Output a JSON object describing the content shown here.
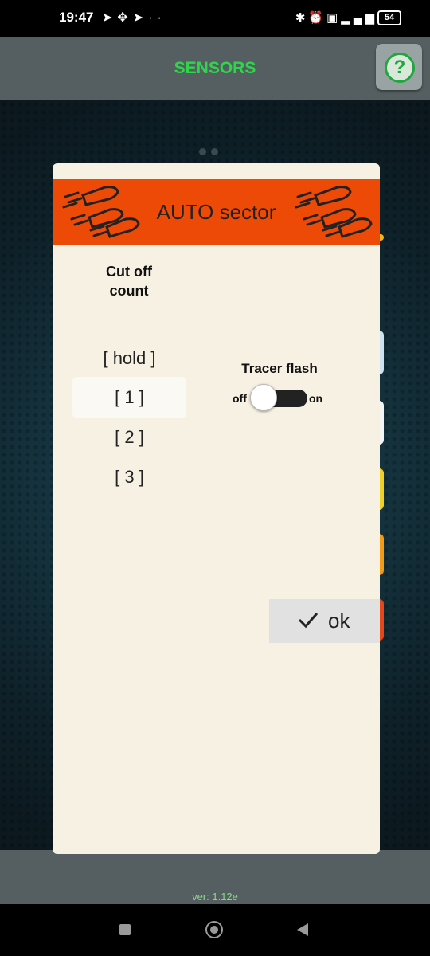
{
  "status_bar": {
    "time": "19:47",
    "left_icons": [
      "telegram-icon",
      "pinwheel-icon",
      "telegram-icon",
      "dots-icon"
    ],
    "right_icons": [
      "bluetooth-icon",
      "alarm-icon",
      "volte-icon",
      "4g-signal-icon"
    ],
    "battery": "54"
  },
  "header": {
    "title": "SENSORS",
    "help": "?",
    "title_color": "#2ed64a"
  },
  "dialog": {
    "title": "AUTO sector",
    "header_color": "#ee4a07",
    "cutoff": {
      "label_line1": "Cut off",
      "label_line2": "count",
      "options": [
        "[ hold ]",
        "[ 1 ]",
        "[ 2 ]",
        "[ 3 ]"
      ],
      "selected": "[ 1 ]"
    },
    "tracer": {
      "label": "Tracer flash",
      "off": "off",
      "on": "on",
      "state": "off"
    },
    "ok_label": "ok"
  },
  "footer": {
    "version": "ver: 1.12e"
  }
}
